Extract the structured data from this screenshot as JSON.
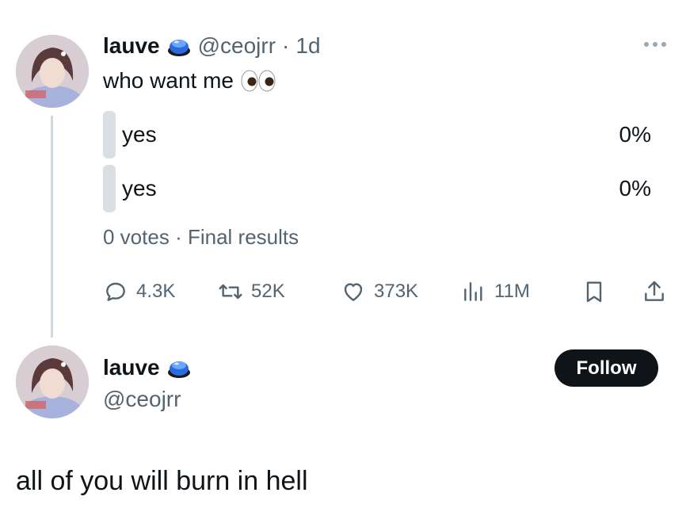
{
  "tweet": {
    "author_name": "lauve",
    "author_handle": "@ceojrr",
    "separator": "·",
    "time": "1d",
    "text": "who want me",
    "emoji_icon": "eyes-emoji",
    "badge_icon": "blue-button-emoji",
    "more_icon": "more-dots-icon",
    "poll": {
      "options": [
        {
          "label": "yes",
          "percent_text": "0%",
          "percent_value": 0
        },
        {
          "label": "yes",
          "percent_text": "0%",
          "percent_value": 0
        }
      ],
      "votes": "0 votes",
      "meta_separator": "·",
      "status": "Final results"
    },
    "actions": {
      "replies": "4.3K",
      "retweets": "52K",
      "likes": "373K",
      "views": "11M",
      "reply_icon": "comment-icon",
      "retweet_icon": "retweet-icon",
      "like_icon": "heart-icon",
      "views_icon": "views-chart-icon",
      "bookmark_icon": "bookmark-icon",
      "share_icon": "share-icon"
    }
  },
  "profile_card": {
    "name": "lauve",
    "handle": "@ceojrr",
    "follow_label": "Follow",
    "badge_icon": "blue-button-emoji"
  },
  "reply": {
    "text": "all of you will burn in hell"
  },
  "colors": {
    "text_primary": "#0f1419",
    "text_secondary": "#536471",
    "poll_bar": "#d9dfe3",
    "thread_line": "#cfd9de",
    "follow_bg": "#0f1419",
    "follow_text": "#ffffff"
  }
}
